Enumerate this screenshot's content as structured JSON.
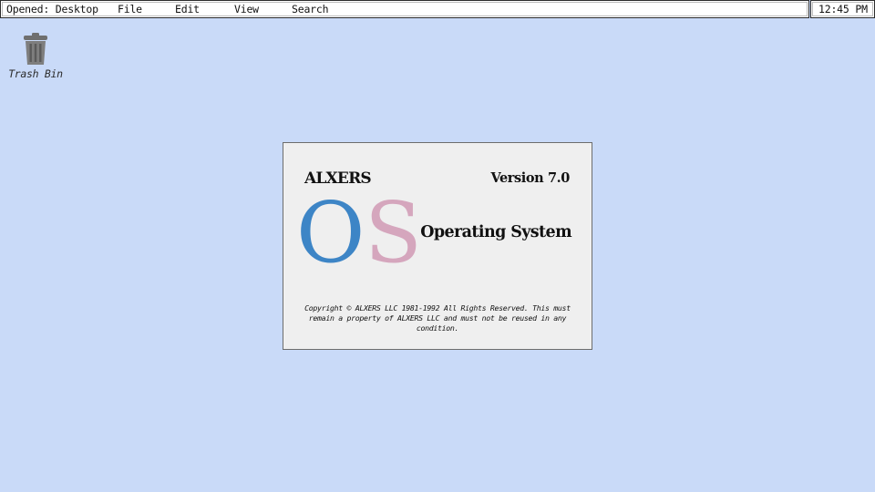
{
  "menubar": {
    "opened_label": "Opened: Desktop",
    "items": [
      {
        "label": "File"
      },
      {
        "label": "Edit"
      },
      {
        "label": "View"
      },
      {
        "label": "Search"
      }
    ],
    "clock": "12:45 PM"
  },
  "desktop": {
    "background_color": "#c9daf8",
    "icons": [
      {
        "label": "Trash Bin",
        "icon": "trash-bin-icon"
      }
    ]
  },
  "splash": {
    "brand": "ALXERS",
    "version": "Version 7.0",
    "logo_letter_1": "O",
    "logo_letter_2": "S",
    "logo_color_1": "#3d85c6",
    "logo_color_2": "#d5a6bd",
    "product": "Operating System",
    "copyright": "Copyright © ALXERS LLC 1981-1992 All Rights Reserved. This must remain a property of ALXERS LLC and must not be reused in any condition."
  }
}
